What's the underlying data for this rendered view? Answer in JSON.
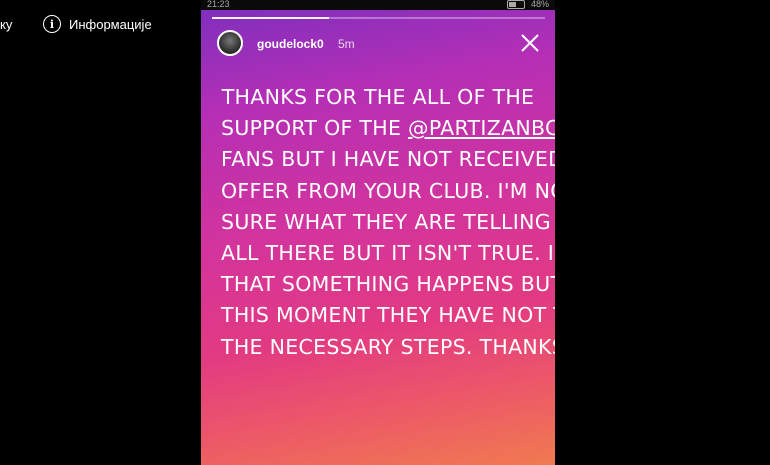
{
  "viewer": {
    "left_label": "ку",
    "info_label": "Информације",
    "info_icon": "info-icon"
  },
  "status_bar": {
    "time": "21:23",
    "battery": "48%"
  },
  "story": {
    "progress": 0.35,
    "username": "goudelock0",
    "time_ago": "5m",
    "mention": "@PARTIZANBC",
    "lines": [
      "THANKS FOR THE ALL OF THE",
      "SUPPORT OF THE ",
      "FANS BUT I HAVE NOT RECEIVED ANY",
      "OFFER FROM YOUR CLUB. I'M NOT",
      "SURE WHAT THEY ARE TELLING YOU",
      "ALL THERE BUT IT ISN'T TRUE. I HOPE",
      "THAT SOMETHING HAPPENS BUT AT",
      "THIS MOMENT THEY HAVE NOT TAKEN",
      "THE NECESSARY STEPS. THANKS"
    ]
  }
}
